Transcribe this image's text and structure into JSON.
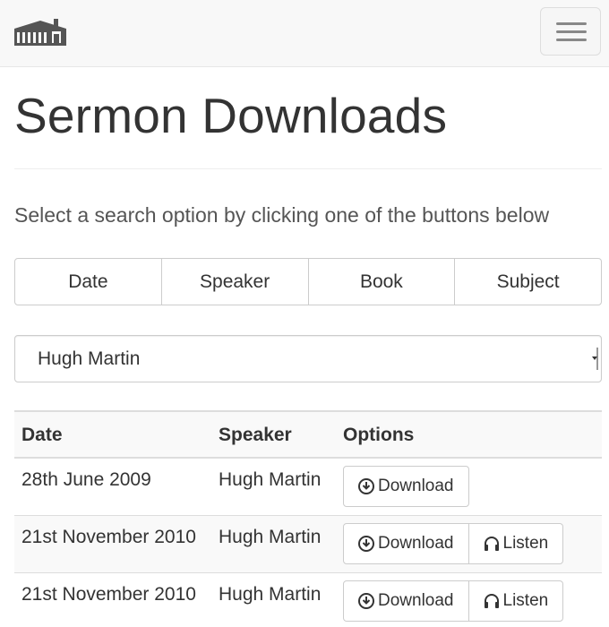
{
  "navbar": {
    "logo_icon": "church-building-icon",
    "menu_icon": "hamburger-menu-icon"
  },
  "page": {
    "title": "Sermon Downloads",
    "lead": "Select a search option by clicking one of the buttons below"
  },
  "search_options": [
    {
      "label": "Date"
    },
    {
      "label": "Speaker"
    },
    {
      "label": "Book"
    },
    {
      "label": "Subject"
    }
  ],
  "select": {
    "value": "Hugh Martin"
  },
  "table": {
    "headers": {
      "date": "Date",
      "speaker": "Speaker",
      "options": "Options"
    },
    "rows": [
      {
        "date": "28th June 2009",
        "speaker": "Hugh Martin",
        "download": "Download",
        "listen": null
      },
      {
        "date": "21st November 2010",
        "speaker": "Hugh Martin",
        "download": "Download",
        "listen": "Listen"
      },
      {
        "date": "21st November 2010",
        "speaker": "Hugh Martin",
        "download": "Download",
        "listen": "Listen"
      }
    ],
    "icons": {
      "download": "download-circle-icon",
      "listen": "headphones-icon"
    }
  },
  "colors": {
    "navbar_bg": "#f8f8f8",
    "text": "#333333",
    "border": "#cccccc"
  }
}
